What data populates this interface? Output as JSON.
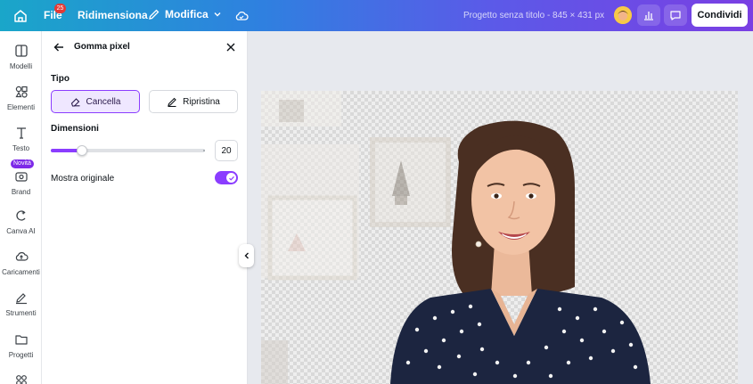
{
  "topbar": {
    "file_label": "File",
    "file_badge": "25",
    "resize_label": "Ridimensiona",
    "edit_label": "Modifica",
    "doc_title": "Progetto senza titolo - 845 × 431 px",
    "share_label": "Condividi"
  },
  "rail": {
    "items": [
      {
        "label": "Modelli",
        "icon": "layout-icon"
      },
      {
        "label": "Elementi",
        "icon": "shapes-icon"
      },
      {
        "label": "Testo",
        "icon": "text-icon"
      },
      {
        "label": "Brand",
        "icon": "brand-icon"
      },
      {
        "label": "Canva AI",
        "icon": "ai-icon"
      },
      {
        "label": "Caricamenti",
        "icon": "upload-icon"
      },
      {
        "label": "Strumenti",
        "icon": "tools-icon"
      },
      {
        "label": "Progetti",
        "icon": "folder-icon"
      }
    ],
    "new_badge": "Novità"
  },
  "panel": {
    "title": "Gomma pixel",
    "type_heading": "Tipo",
    "erase_label": "Cancella",
    "restore_label": "Ripristina",
    "size_heading": "Dimensioni",
    "size_value": "20",
    "size_fraction": 0.2,
    "show_original_label": "Mostra originale",
    "show_original_on": true
  },
  "colors": {
    "accent": "#8b3dff",
    "topbar_start": "#1aa6c9",
    "topbar_end": "#7a3fe3"
  }
}
